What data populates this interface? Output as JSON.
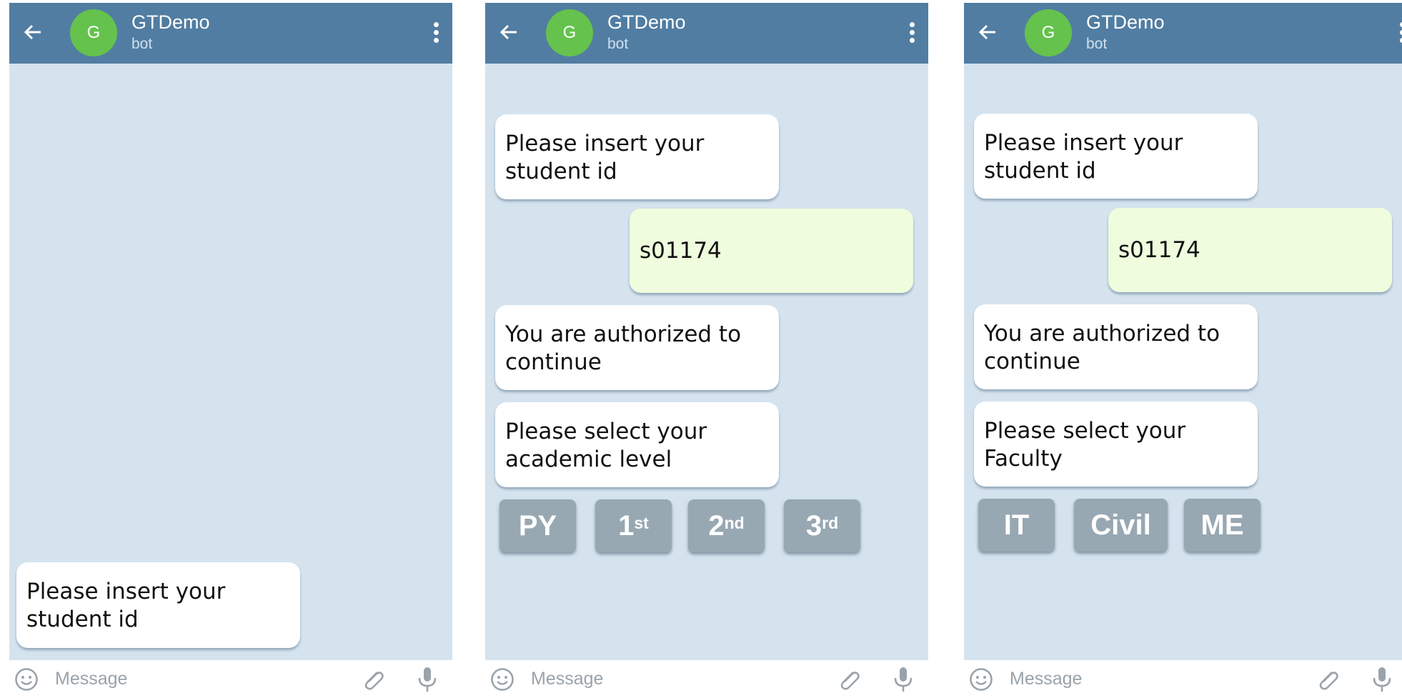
{
  "header": {
    "avatar_letter": "G",
    "title": "GTDemo",
    "subtitle": "bot"
  },
  "input": {
    "placeholder": "Message"
  },
  "screens": [
    {
      "messages": [
        {
          "side": "in",
          "text": "Please insert your student id"
        }
      ]
    },
    {
      "messages": [
        {
          "side": "in",
          "text": "Please insert your student id"
        },
        {
          "side": "out",
          "text": "s01174"
        },
        {
          "side": "in",
          "text": "You are authorized to continue"
        },
        {
          "side": "in",
          "text": "Please select your academic level"
        }
      ],
      "keyboard": [
        {
          "main": "PY",
          "sup": ""
        },
        {
          "main": "1",
          "sup": "st"
        },
        {
          "main": "2",
          "sup": "nd"
        },
        {
          "main": "3",
          "sup": "rd"
        }
      ]
    },
    {
      "messages": [
        {
          "side": "in",
          "text": "Please insert your student id"
        },
        {
          "side": "out",
          "text": "s01174"
        },
        {
          "side": "in",
          "text": "You are authorized to continue"
        },
        {
          "side": "in",
          "text": "Please select your Faculty"
        }
      ],
      "keyboard": [
        {
          "main": "IT",
          "sup": ""
        },
        {
          "main": "Civil",
          "sup": ""
        },
        {
          "main": "ME",
          "sup": ""
        }
      ]
    }
  ]
}
